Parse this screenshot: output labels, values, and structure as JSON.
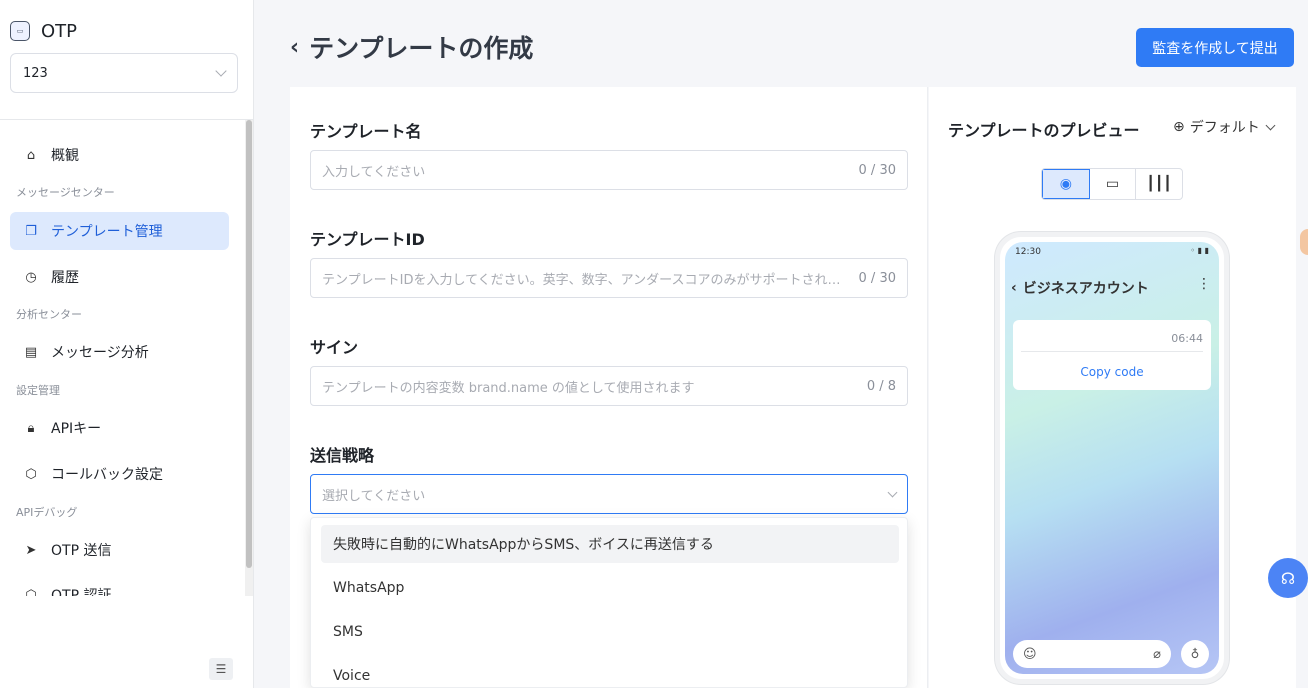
{
  "sidebar": {
    "app_name": "OTP",
    "project_select": "123",
    "items": [
      {
        "label": "概観",
        "icon": "home-icon"
      },
      {
        "caption": "メッセージセンター"
      },
      {
        "label": "テンプレート管理",
        "icon": "template-icon",
        "active": true
      },
      {
        "label": "履歴",
        "icon": "history-icon"
      },
      {
        "caption": "分析センター"
      },
      {
        "label": "メッセージ分析",
        "icon": "chart-icon"
      },
      {
        "caption": "設定管理"
      },
      {
        "label": "APIキー",
        "icon": "lock-icon"
      },
      {
        "label": "コールバック設定",
        "icon": "callback-icon"
      },
      {
        "caption": "APIデバッグ"
      },
      {
        "label": "OTP 送信",
        "icon": "send-icon"
      },
      {
        "label": "OTP 認証",
        "icon": "verify-icon"
      }
    ]
  },
  "header": {
    "title": "テンプレートの作成",
    "submit_label": "監査を作成して提出"
  },
  "form": {
    "name": {
      "label": "テンプレート名",
      "placeholder": "入力してください",
      "count": "0 / 30"
    },
    "id": {
      "label": "テンプレートID",
      "placeholder": "テンプレートIDを入力してください。英字、数字、アンダースコアのみがサポートされます",
      "count": "0 / 30"
    },
    "sign": {
      "label": "サイン",
      "placeholder": "テンプレートの内容変数 brand.name の値として使用されます",
      "count": "0 / 8"
    },
    "strategy": {
      "label": "送信戦略",
      "placeholder": "選択してください",
      "options": [
        "失敗時に自動的にWhatsAppからSMS、ボイスに再送信する",
        "WhatsApp",
        "SMS",
        "Voice"
      ]
    }
  },
  "preview": {
    "title": "テンプレートのプレビュー",
    "language": "デフォルト",
    "phone": {
      "time": "12:30",
      "chat_title": "ビジネスアカウント",
      "msg_time": "06:44",
      "copy_button": "Copy code"
    }
  },
  "colors": {
    "accent": "#2f7bf5",
    "active_bg": "#dde9fd"
  }
}
